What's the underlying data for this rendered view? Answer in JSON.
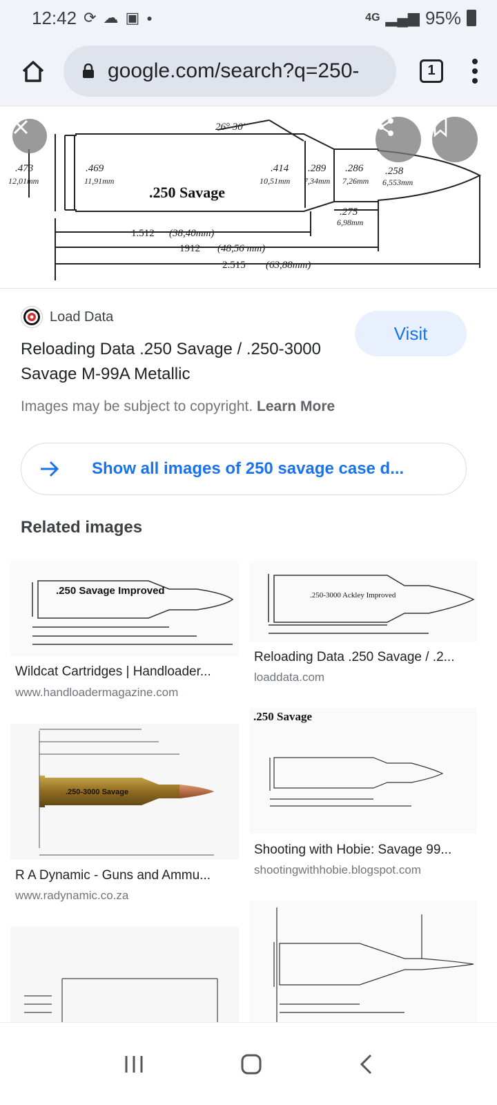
{
  "status_bar": {
    "time": "12:42",
    "network": "4G",
    "battery": "95%"
  },
  "browser": {
    "url": "google.com/search?q=250-",
    "tab_count": "1"
  },
  "preview": {
    "diagram_title": ".250 Savage",
    "angle_label": "26° 30'",
    "labels": {
      "rim": ".473",
      "rim_mm": "12,01mm",
      "base": ".469",
      "base_mm": "11,91mm",
      "shoulder": ".414",
      "shoulder_mm": "10,51mm",
      "neck_a": ".289",
      "neck_a_mm": "7,34mm",
      "neck_b": ".286",
      "neck_b_mm": "7,26mm",
      "bullet": ".258",
      "bullet_mm": "6,553mm",
      "neck_len": ".275",
      "neck_len_mm": "6,98mm",
      "len1": "1.512",
      "len1_mm": "(38,40mm)",
      "len2": "1912",
      "len2_mm": "(48,56 mm)",
      "len3": "2.515",
      "len3_mm": "(63,88mm)"
    }
  },
  "result": {
    "source": "Load Data",
    "title": "Reloading Data .250 Savage / .250-3000 Savage M-99A Metallic",
    "visit_label": "Visit",
    "copyright_text": "Images may be subject to copyright.",
    "learn_more": "Learn More",
    "show_all": "Show all images of 250 savage case d..."
  },
  "related": {
    "heading": "Related images",
    "cards": [
      {
        "title": "Wildcat Cartridges | Handloader...",
        "domain": "www.handloadermagazine.com",
        "thumb_text": ".250 Savage Improved"
      },
      {
        "title": "Reloading Data .250 Savage / .2...",
        "domain": "loaddata.com",
        "thumb_text": ".250-3000 Ackley Improved"
      },
      {
        "title": "R A Dynamic - Guns and Ammu...",
        "domain": "www.radynamic.co.za",
        "thumb_text": ".250-3000 Savage"
      },
      {
        "title": "Shooting with Hobie: Savage 99...",
        "domain": "shootingwithhobie.blogspot.com",
        "thumb_text": ".250 Savage"
      }
    ]
  }
}
